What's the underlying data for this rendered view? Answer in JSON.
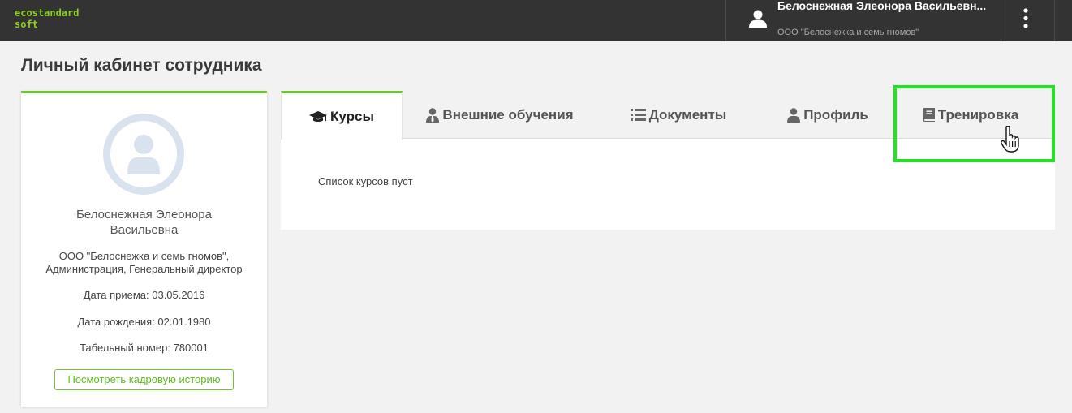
{
  "header": {
    "logo_line1": "ecostandard",
    "logo_line2": "soft",
    "user_name": "Белоснежная Элеонора Васильевн...",
    "user_org": "ООО \"Белоснежка и семь гномов\""
  },
  "page_title": "Личный кабинет сотрудника",
  "employee": {
    "name": "Белоснежная Элеонора Васильевна",
    "org": "ООО \"Белоснежка и семь гномов\", Администрация, Генеральный директор",
    "hire_date": "Дата приема: 03.05.2016",
    "birth_date": "Дата рождения: 02.01.1980",
    "tab_number": "Табельный номер: 780001",
    "history_button": "Посмотреть кадровую историю"
  },
  "tabs": [
    {
      "label": "Курсы",
      "icon": "graduation-cap-icon",
      "active": true
    },
    {
      "label": "Внешние обучения",
      "icon": "user-tie-icon",
      "active": false
    },
    {
      "label": "Документы",
      "icon": "list-icon",
      "active": false
    },
    {
      "label": "Профиль",
      "icon": "user-icon",
      "active": false
    },
    {
      "label": "Тренировка",
      "icon": "book-icon",
      "active": false
    }
  ],
  "courses_empty": "Список курсов пуст",
  "colors": {
    "accent": "#6dc82b",
    "logo": "#8cd11b",
    "topbar": "#333333",
    "highlight": "#22e322"
  }
}
